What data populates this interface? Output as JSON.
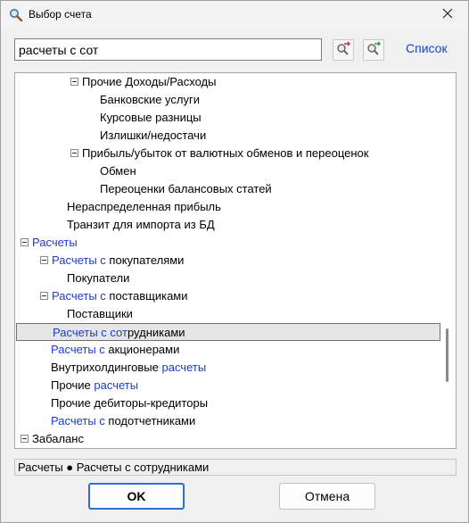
{
  "window": {
    "title": "Выбор счета",
    "icons": {
      "app": "search-icon",
      "close": "close-icon"
    }
  },
  "search": {
    "value": "расчеты с сот",
    "buttons": [
      "filter-clear-icon",
      "filter-apply-icon"
    ],
    "list_label": "Список"
  },
  "tree": {
    "rows": [
      {
        "parts": [
          {
            "t": "Прочие Доходы/Расходы",
            "h": false
          }
        ],
        "toggle": true
      },
      {
        "parts": [
          {
            "t": "Банковские услуги",
            "h": false
          }
        ],
        "toggle": false
      },
      {
        "parts": [
          {
            "t": "Курсовые разницы",
            "h": false
          }
        ],
        "toggle": false
      },
      {
        "parts": [
          {
            "t": "Излишки/недостачи",
            "h": false
          }
        ],
        "toggle": false
      },
      {
        "parts": [
          {
            "t": "Прибыль/убыток от валютных обменов и переоценок",
            "h": false
          }
        ],
        "toggle": true
      },
      {
        "parts": [
          {
            "t": "Обмен",
            "h": false
          }
        ],
        "toggle": false
      },
      {
        "parts": [
          {
            "t": "Переоценки балансовых статей",
            "h": false
          }
        ],
        "toggle": false
      },
      {
        "parts": [
          {
            "t": "Нераспределенная прибыль",
            "h": false
          }
        ],
        "toggle": false
      },
      {
        "parts": [
          {
            "t": "Транзит для импорта из БД",
            "h": false
          }
        ],
        "toggle": false
      },
      {
        "parts": [
          {
            "t": "Расчеты",
            "h": true
          }
        ],
        "toggle": true
      },
      {
        "parts": [
          {
            "t": "Расчеты с",
            "h": true
          },
          {
            "t": " покупателями",
            "h": false
          }
        ],
        "toggle": true
      },
      {
        "parts": [
          {
            "t": "Покупатели",
            "h": false
          }
        ],
        "toggle": false
      },
      {
        "parts": [
          {
            "t": "Расчеты с",
            "h": true
          },
          {
            "t": " поставщиками",
            "h": false
          }
        ],
        "toggle": true
      },
      {
        "parts": [
          {
            "t": "Поставщики",
            "h": false
          }
        ],
        "toggle": false
      },
      {
        "parts": [
          {
            "t": "Расчеты с сот",
            "h": true
          },
          {
            "t": "рудниками",
            "h": false
          }
        ],
        "toggle": false,
        "selected": true
      },
      {
        "parts": [
          {
            "t": "Расчеты с",
            "h": true
          },
          {
            "t": " акционерами",
            "h": false
          }
        ],
        "toggle": false
      },
      {
        "parts": [
          {
            "t": "Внутрихолдинговые ",
            "h": false
          },
          {
            "t": "расчеты",
            "h": true
          }
        ],
        "toggle": false
      },
      {
        "parts": [
          {
            "t": "Прочие ",
            "h": false
          },
          {
            "t": "расчеты",
            "h": true
          }
        ],
        "toggle": false
      },
      {
        "parts": [
          {
            "t": "Прочие дебиторы-кредиторы",
            "h": false
          }
        ],
        "toggle": false
      },
      {
        "parts": [
          {
            "t": "Расчеты с",
            "h": true
          },
          {
            "t": " подотчетниками",
            "h": false
          }
        ],
        "toggle": false
      },
      {
        "parts": [
          {
            "t": "Забаланс",
            "h": false
          }
        ],
        "toggle": true
      }
    ]
  },
  "status": {
    "path": "Расчеты ● Расчеты с сотрудниками"
  },
  "buttons": {
    "ok": "OK",
    "cancel": "Отмена"
  },
  "colors": {
    "highlight": "#1c3cd0",
    "accent": "#2f6fd0"
  }
}
